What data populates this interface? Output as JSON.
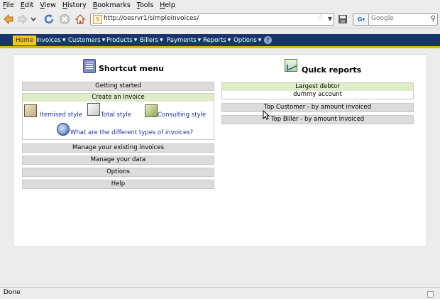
{
  "menubar": {
    "items": [
      {
        "label": "File",
        "u": "F",
        "rest": "ile"
      },
      {
        "label": "Edit",
        "u": "E",
        "rest": "dit"
      },
      {
        "label": "View",
        "u": "V",
        "rest": "iew"
      },
      {
        "label": "History",
        "u": "H",
        "rest": "istory"
      },
      {
        "label": "Bookmarks",
        "u": "B",
        "rest": "ookmarks"
      },
      {
        "label": "Tools",
        "u": "T",
        "rest": "ools"
      },
      {
        "label": "Help",
        "u": "H",
        "rest": "elp"
      }
    ]
  },
  "navbar": {
    "url": "http://oesrvr1/simpleinvoices/",
    "search_placeholder": "Google",
    "icons": {
      "back": "back-arrow-icon",
      "forward": "forward-arrow-icon",
      "history": "chevron-down-icon",
      "reload": "reload-icon",
      "stop": "stop-icon",
      "home": "home-icon"
    }
  },
  "tabs": [
    {
      "label": "Home",
      "active": true
    },
    {
      "label": "Invoices",
      "arrow": "▼"
    },
    {
      "label": "Customers",
      "arrow": "▼"
    },
    {
      "label": "Products",
      "arrow": "▼"
    },
    {
      "label": "Billers",
      "arrow": "▼"
    },
    {
      "label": "Payments",
      "arrow": "▼"
    },
    {
      "label": "Reports",
      "arrow": "▼"
    },
    {
      "label": "Options",
      "arrow": "▼"
    }
  ],
  "help_glyph": "?",
  "shortcut": {
    "title": "Shortcut menu",
    "getting_started": "Getting started",
    "create_invoice": "Create an invoice",
    "itemised": "Itemised style",
    "total": "Total style",
    "consulting": "Consulting style",
    "types_question": "What are the different types of invoices?",
    "manage_invoices": "Manage your existing invoices",
    "manage_data": "Manage your data",
    "options": "Options",
    "help": "Help"
  },
  "reports": {
    "title": "Quick reports",
    "largest_debtor": "Largest debtor",
    "debtor_name": "dummy account",
    "top_customer": "Top Customer - by amount invoiced",
    "top_biller": "Top Biller - by amount invoiced"
  },
  "status": {
    "text": "Done"
  },
  "colors": {
    "nav_bar": "#17366d",
    "active_tab": "#f5c523",
    "accent_stripe": "#e0b31b",
    "green_header": "#e0ecc9",
    "link": "#1a33a8"
  }
}
